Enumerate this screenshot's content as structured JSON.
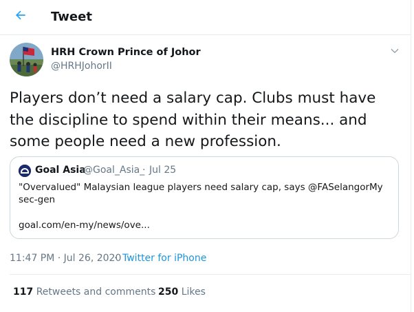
{
  "header": {
    "title": "Tweet",
    "back_icon": "arrow-left-icon"
  },
  "tweet": {
    "author": {
      "name": "HRH Crown Prince of Johor",
      "handle": "@HRHJohorII"
    },
    "text": "Players don’t need a salary cap. Clubs must have the discipline to spend within their means... and some people need a new profession.",
    "quote": {
      "name": "Goal Asia",
      "handle": "@Goal_Asia_",
      "separator": "·",
      "date": "Jul 25",
      "text": "\"Overvalued\" Malaysian league players need salary cap, says @FASelangorMy sec-gen",
      "link": "goal.com/en-my/news/ove..."
    },
    "timestamp": "11:47 PM · Jul 26, 2020",
    "separator": "·",
    "source": "Twitter for iPhone",
    "stats": {
      "retweets_count": "117",
      "retweets_label": "Retweets and comments",
      "likes_count": "250",
      "likes_label": "Likes"
    }
  },
  "colors": {
    "accent": "#1da1f2",
    "link": "#1b95e0",
    "secondary_text": "#657786",
    "border": "#e6ecf0"
  }
}
